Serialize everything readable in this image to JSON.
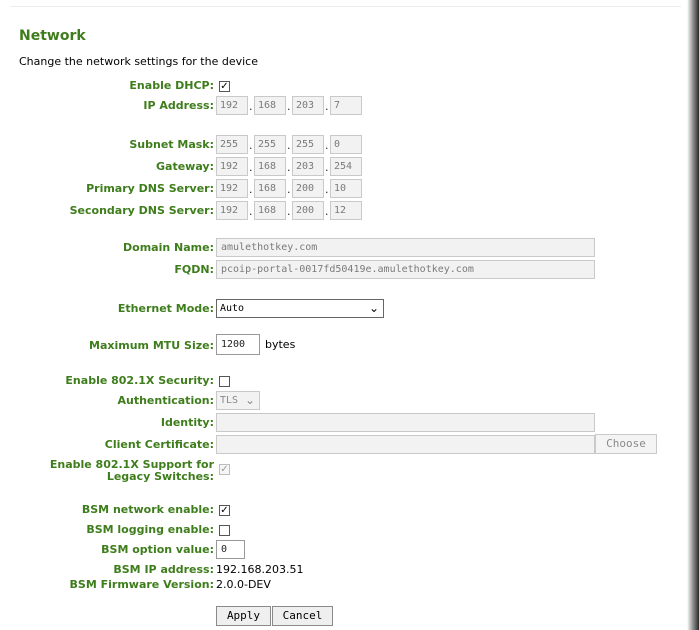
{
  "page": {
    "title": "Network",
    "subtitle": "Change the network settings for the device"
  },
  "dhcp": {
    "label": "Enable DHCP:",
    "checked": true
  },
  "ip_address": {
    "label": "IP Address:",
    "octets": [
      "192",
      "168",
      "203",
      "7"
    ]
  },
  "subnet_mask": {
    "label": "Subnet Mask:",
    "octets": [
      "255",
      "255",
      "255",
      "0"
    ]
  },
  "gateway": {
    "label": "Gateway:",
    "octets": [
      "192",
      "168",
      "203",
      "254"
    ]
  },
  "primary_dns": {
    "label": "Primary DNS Server:",
    "octets": [
      "192",
      "168",
      "200",
      "10"
    ]
  },
  "secondary_dns": {
    "label": "Secondary DNS Server:",
    "octets": [
      "192",
      "168",
      "200",
      "12"
    ]
  },
  "domain_name": {
    "label": "Domain Name:",
    "value": "amulethotkey.com"
  },
  "fqdn": {
    "label": "FQDN:",
    "value": "pcoip-portal-0017fd50419e.amulethotkey.com"
  },
  "ethernet_mode": {
    "label": "Ethernet Mode:",
    "value": "Auto"
  },
  "mtu": {
    "label": "Maximum MTU Size:",
    "value": "1200",
    "unit": "bytes"
  },
  "security_8021x": {
    "label": "Enable 802.1X Security:",
    "checked": false
  },
  "authentication": {
    "label": "Authentication:",
    "value": "TLS"
  },
  "identity": {
    "label": "Identity:",
    "value": ""
  },
  "client_certificate": {
    "label": "Client Certificate:",
    "value": "",
    "button": "Choose"
  },
  "legacy_switches": {
    "label_line1": "Enable 802.1X Support for",
    "label_line2": "Legacy Switches:",
    "checked": true
  },
  "bsm_network": {
    "label": "BSM network enable:",
    "checked": true
  },
  "bsm_logging": {
    "label": "BSM logging enable:",
    "checked": false
  },
  "bsm_option": {
    "label": "BSM option value:",
    "value": "0"
  },
  "bsm_ip": {
    "label": "BSM IP address:",
    "value": "192.168.203.51"
  },
  "bsm_firmware": {
    "label": "BSM Firmware Version:",
    "value": "2.0.0-DEV"
  },
  "actions": {
    "apply": "Apply",
    "cancel": "Cancel"
  },
  "colors": {
    "label_green": "#3e7d1b",
    "field_bg": "#f2f2f2"
  },
  "icons": {
    "check": "check-mark-icon",
    "chevron": "chevron-down-icon"
  }
}
